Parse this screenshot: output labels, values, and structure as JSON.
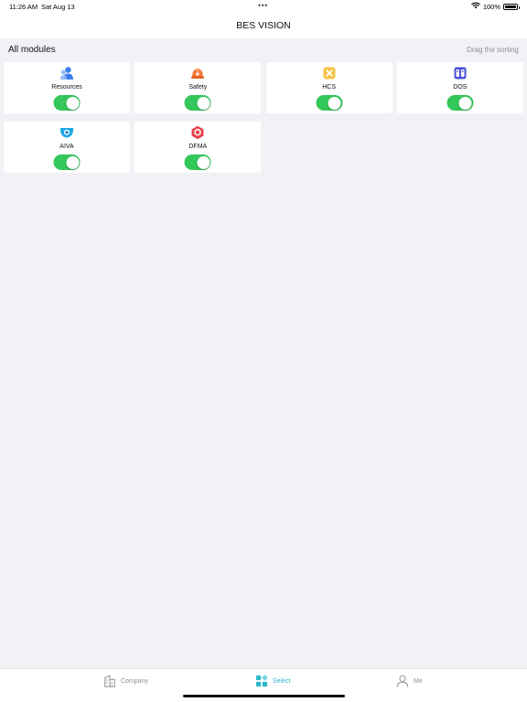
{
  "status_bar": {
    "time": "11:26 AM",
    "date": "Sat Aug 13",
    "more_dots": "•••",
    "battery_text": "100%",
    "battery_level": 1.0
  },
  "nav": {
    "title": "BES VISION"
  },
  "section": {
    "title": "All modules",
    "action": "Drag the sorting"
  },
  "modules": [
    {
      "label": "Resources",
      "icon": "resources-icon",
      "enabled": true,
      "color": "#3b7ded"
    },
    {
      "label": "Safety",
      "icon": "safety-helmet-icon",
      "enabled": true,
      "color": "#f57c3b"
    },
    {
      "label": "HCS",
      "icon": "hcs-icon",
      "enabled": true,
      "color": "#f5c342"
    },
    {
      "label": "DOS",
      "icon": "dos-icon",
      "enabled": true,
      "color": "#4a4fd6"
    },
    {
      "label": "AIVA",
      "icon": "camera-icon",
      "enabled": true,
      "color": "#1fa8e6"
    },
    {
      "label": "DFMA",
      "icon": "dfma-icon",
      "enabled": true,
      "color": "#e8414b"
    }
  ],
  "tab_bar": {
    "tabs": [
      {
        "label": "Company",
        "icon": "company-icon",
        "active": false
      },
      {
        "label": "Select",
        "icon": "select-grid-icon",
        "active": true
      },
      {
        "label": "Me",
        "icon": "person-icon",
        "active": false
      }
    ]
  },
  "colors": {
    "toggle_on": "#34c759",
    "active_tab": "#2fb8c9",
    "inactive_tab": "#8e8e93",
    "background": "#f2f2f6"
  }
}
